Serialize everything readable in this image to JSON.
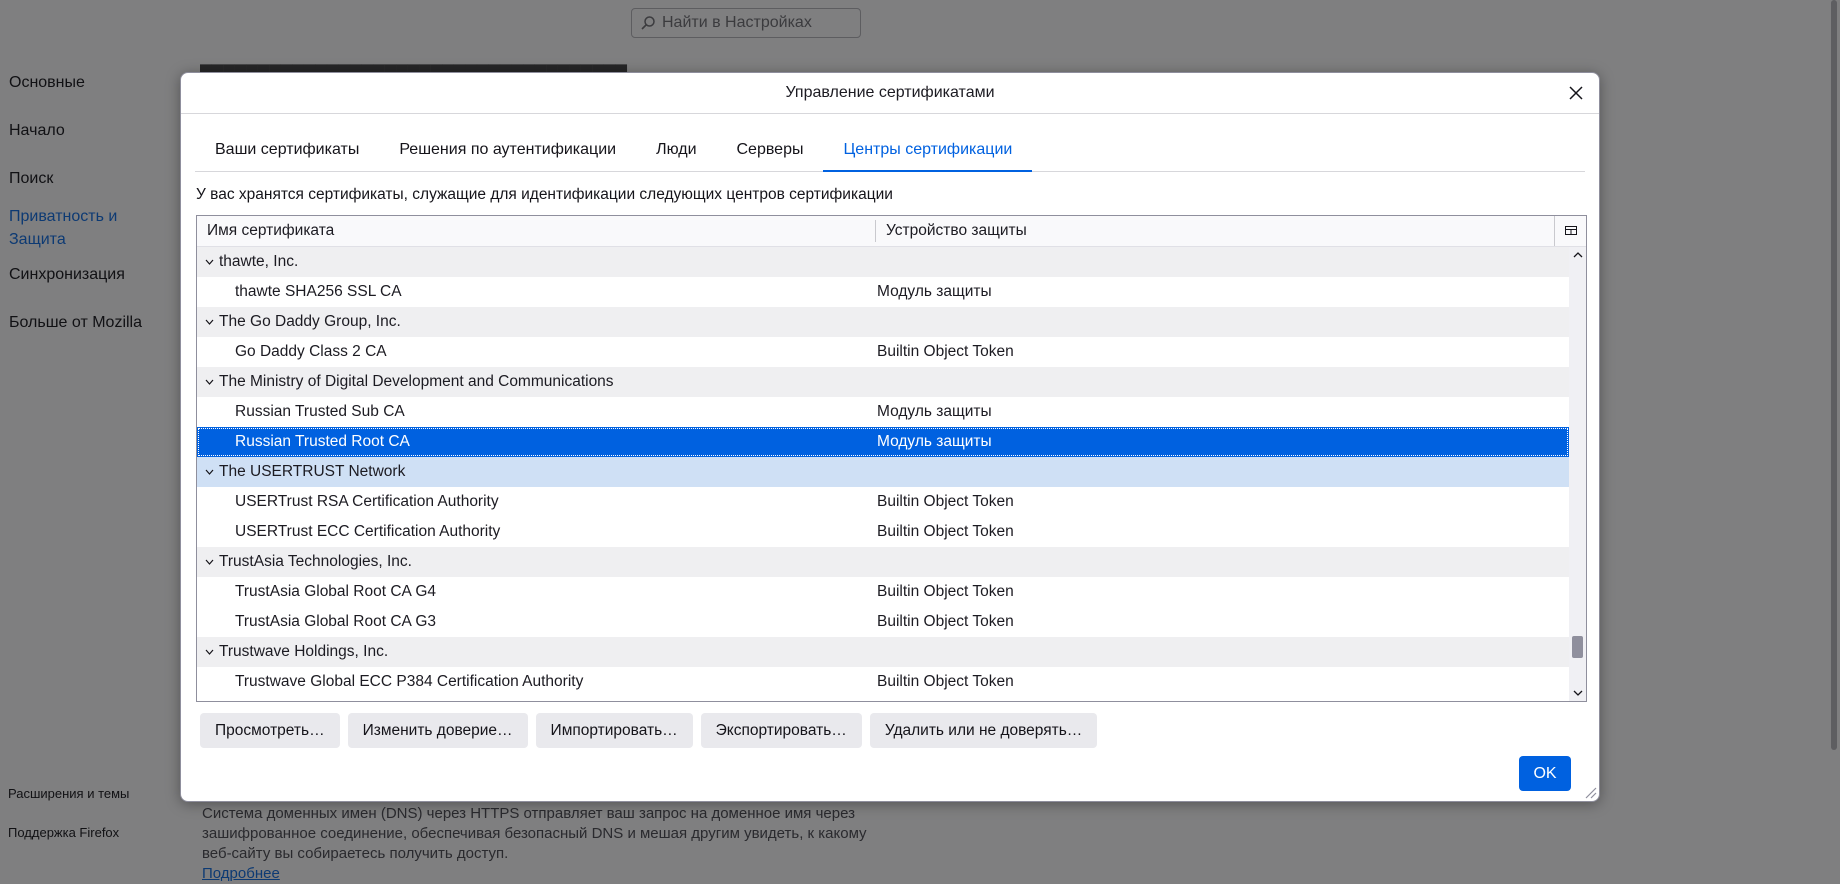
{
  "background": {
    "search_placeholder": "Найти в Настройках",
    "nav": [
      {
        "label": "Основные",
        "active": false
      },
      {
        "label": "Начало",
        "active": false
      },
      {
        "label": "Поиск",
        "active": false
      },
      {
        "label": "Приватность и Защита",
        "active": true
      },
      {
        "label": "Синхронизация",
        "active": false
      },
      {
        "label": "Больше от Mozilla",
        "active": false
      }
    ],
    "footer_links": [
      "Расширения и темы",
      "Поддержка Firefox"
    ],
    "dns_text": "Система доменных имен (DNS) через HTTPS отправляет ваш запрос на доменное имя через зашифрованное соединение, обеспечивая безопасный DNS и мешая другим увидеть, к какому веб-сайту вы собираетесь получить доступ.",
    "dns_link": "Подробнее"
  },
  "dialog": {
    "title": "Управление сертификатами",
    "tabs": [
      {
        "label": "Ваши сертификаты",
        "selected": false
      },
      {
        "label": "Решения по аутентификации",
        "selected": false
      },
      {
        "label": "Люди",
        "selected": false
      },
      {
        "label": "Серверы",
        "selected": false
      },
      {
        "label": "Центры сертификации",
        "selected": true
      }
    ],
    "description": "У вас хранятся сертификаты, служащие для идентификации следующих центров сертификации",
    "columns": {
      "name": "Имя сертификата",
      "token": "Устройство защиты"
    },
    "rows": [
      {
        "type": "group",
        "name": "thawte, Inc."
      },
      {
        "type": "child",
        "name": "thawte SHA256 SSL CA",
        "token": "Модуль защиты"
      },
      {
        "type": "group",
        "name": "The Go Daddy Group, Inc."
      },
      {
        "type": "child",
        "name": "Go Daddy Class 2 CA",
        "token": "Builtin Object Token"
      },
      {
        "type": "group",
        "name": "The Ministry of Digital Development and Communications"
      },
      {
        "type": "child",
        "name": "Russian Trusted Sub CA",
        "token": "Модуль защиты"
      },
      {
        "type": "child",
        "name": "Russian Trusted Root CA",
        "token": "Модуль защиты",
        "selected": true
      },
      {
        "type": "group",
        "name": "The USERTRUST Network",
        "highlight": true
      },
      {
        "type": "child",
        "name": "USERTrust RSA Certification Authority",
        "token": "Builtin Object Token"
      },
      {
        "type": "child",
        "name": "USERTrust ECC Certification Authority",
        "token": "Builtin Object Token"
      },
      {
        "type": "group",
        "name": "TrustAsia Technologies, Inc."
      },
      {
        "type": "child",
        "name": "TrustAsia Global Root CA G4",
        "token": "Builtin Object Token"
      },
      {
        "type": "child",
        "name": "TrustAsia Global Root CA G3",
        "token": "Builtin Object Token"
      },
      {
        "type": "group",
        "name": "Trustwave Holdings, Inc."
      },
      {
        "type": "child",
        "name": "Trustwave Global ECC P384 Certification Authority",
        "token": "Builtin Object Token"
      }
    ],
    "buttons": {
      "view": "Просмотреть…",
      "edit_trust": "Изменить доверие…",
      "import": "Импортировать…",
      "export": "Экспортировать…",
      "delete": "Удалить или не доверять…",
      "ok": "OK"
    }
  },
  "colors": {
    "accent": "#0061e0",
    "overlay": "#7f7f80",
    "row_alt": "#efeff1",
    "selected_parent": "#cfe0f5"
  }
}
